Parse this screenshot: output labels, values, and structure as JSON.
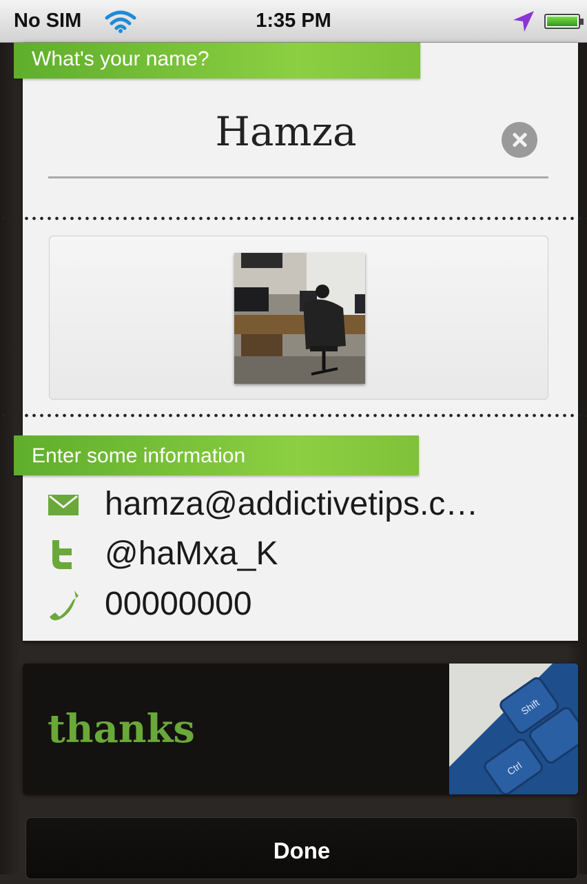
{
  "status_bar": {
    "carrier": "No SIM",
    "time": "1:35 PM"
  },
  "name_section": {
    "label": "What's your name?",
    "value": "Hamza"
  },
  "info_section": {
    "label": "Enter some information",
    "email": "hamza@addictivetips.c…",
    "twitter": "@haMxa_K",
    "phone": "00000000"
  },
  "thanks_banner": {
    "text": "thanks",
    "keyboard_keys": [
      "Shift",
      "Ctrl"
    ]
  },
  "done_button": {
    "label": "Done"
  },
  "colors": {
    "accent_green": "#7fc23a",
    "icon_green": "#6aa83a"
  },
  "icons": {
    "email": "envelope-icon",
    "twitter": "twitter-icon",
    "phone": "phone-icon",
    "clear": "clear-icon"
  }
}
